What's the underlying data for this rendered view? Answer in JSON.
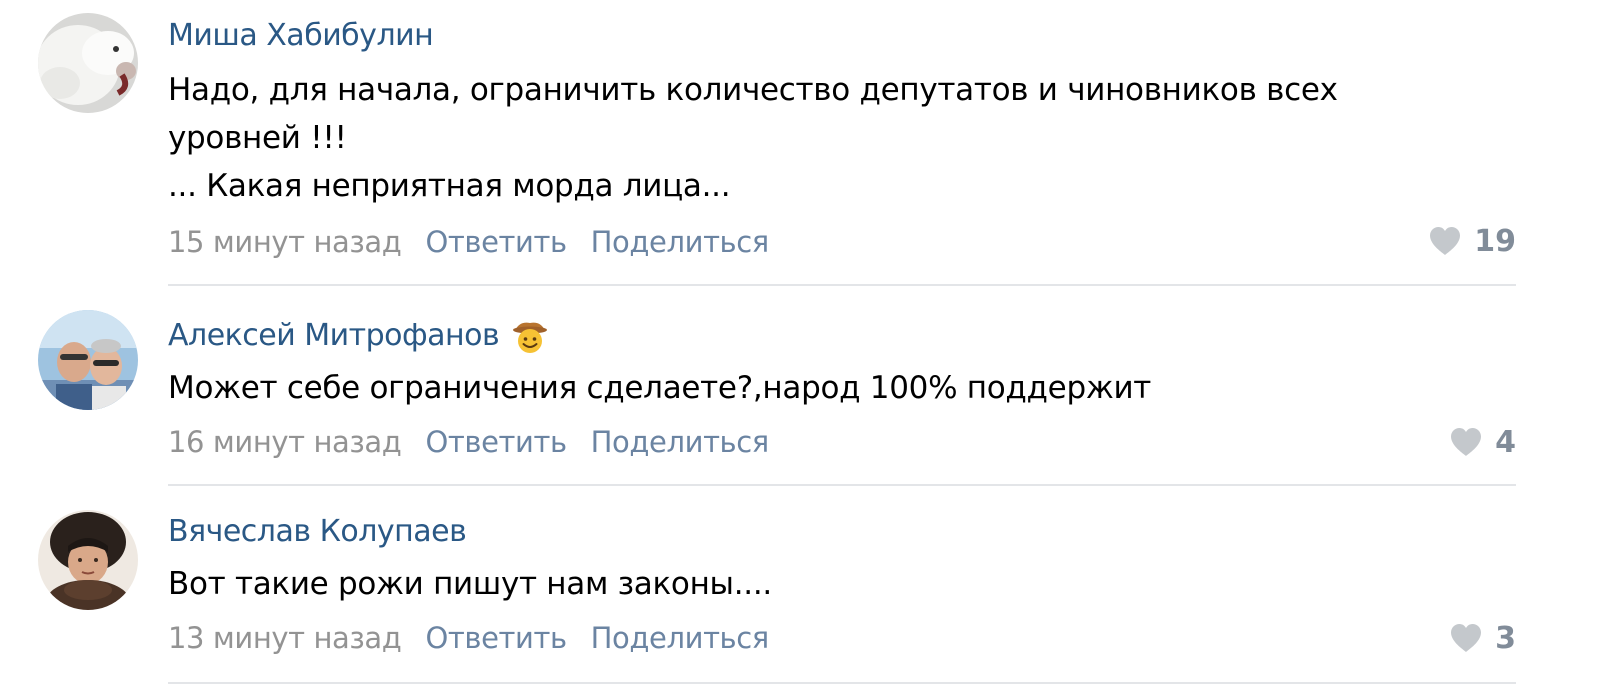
{
  "comments": [
    {
      "author": "Миша Хабибулин",
      "avatar": "white-dog-avatar",
      "text": [
        "Надо, для начала, ограничить количество депутатов и чиновников всех",
        "уровней !!!",
        "... Какая неприятная морда лица..."
      ],
      "time": "15 минут назад",
      "reply_label": "Ответить",
      "share_label": "Поделиться",
      "likes": "19"
    },
    {
      "author": "Алексей Митрофанов",
      "badge": "cowboy-face-emoji",
      "avatar": "couple-photo-avatar",
      "text": [
        "Может себе ограничения сделаете?,народ 100% поддержит"
      ],
      "time": "16 минут назад",
      "reply_label": "Ответить",
      "share_label": "Поделиться",
      "likes": "4"
    },
    {
      "author": "Вячеслав Колупаев",
      "avatar": "person-in-fur-hat-avatar",
      "text": [
        "Вот такие рожи пишут нам законы...."
      ],
      "time": "13 минут назад",
      "reply_label": "Ответить",
      "share_label": "Поделиться",
      "likes": "3"
    }
  ],
  "colors": {
    "author": "#2a5885",
    "text": "#000000",
    "time": "#939393",
    "action": "#6b84a2",
    "likes": "#818c99",
    "heart": "#c4c8cc",
    "divider": "#e3e5e8"
  },
  "icons": {
    "like": "heart-icon"
  }
}
